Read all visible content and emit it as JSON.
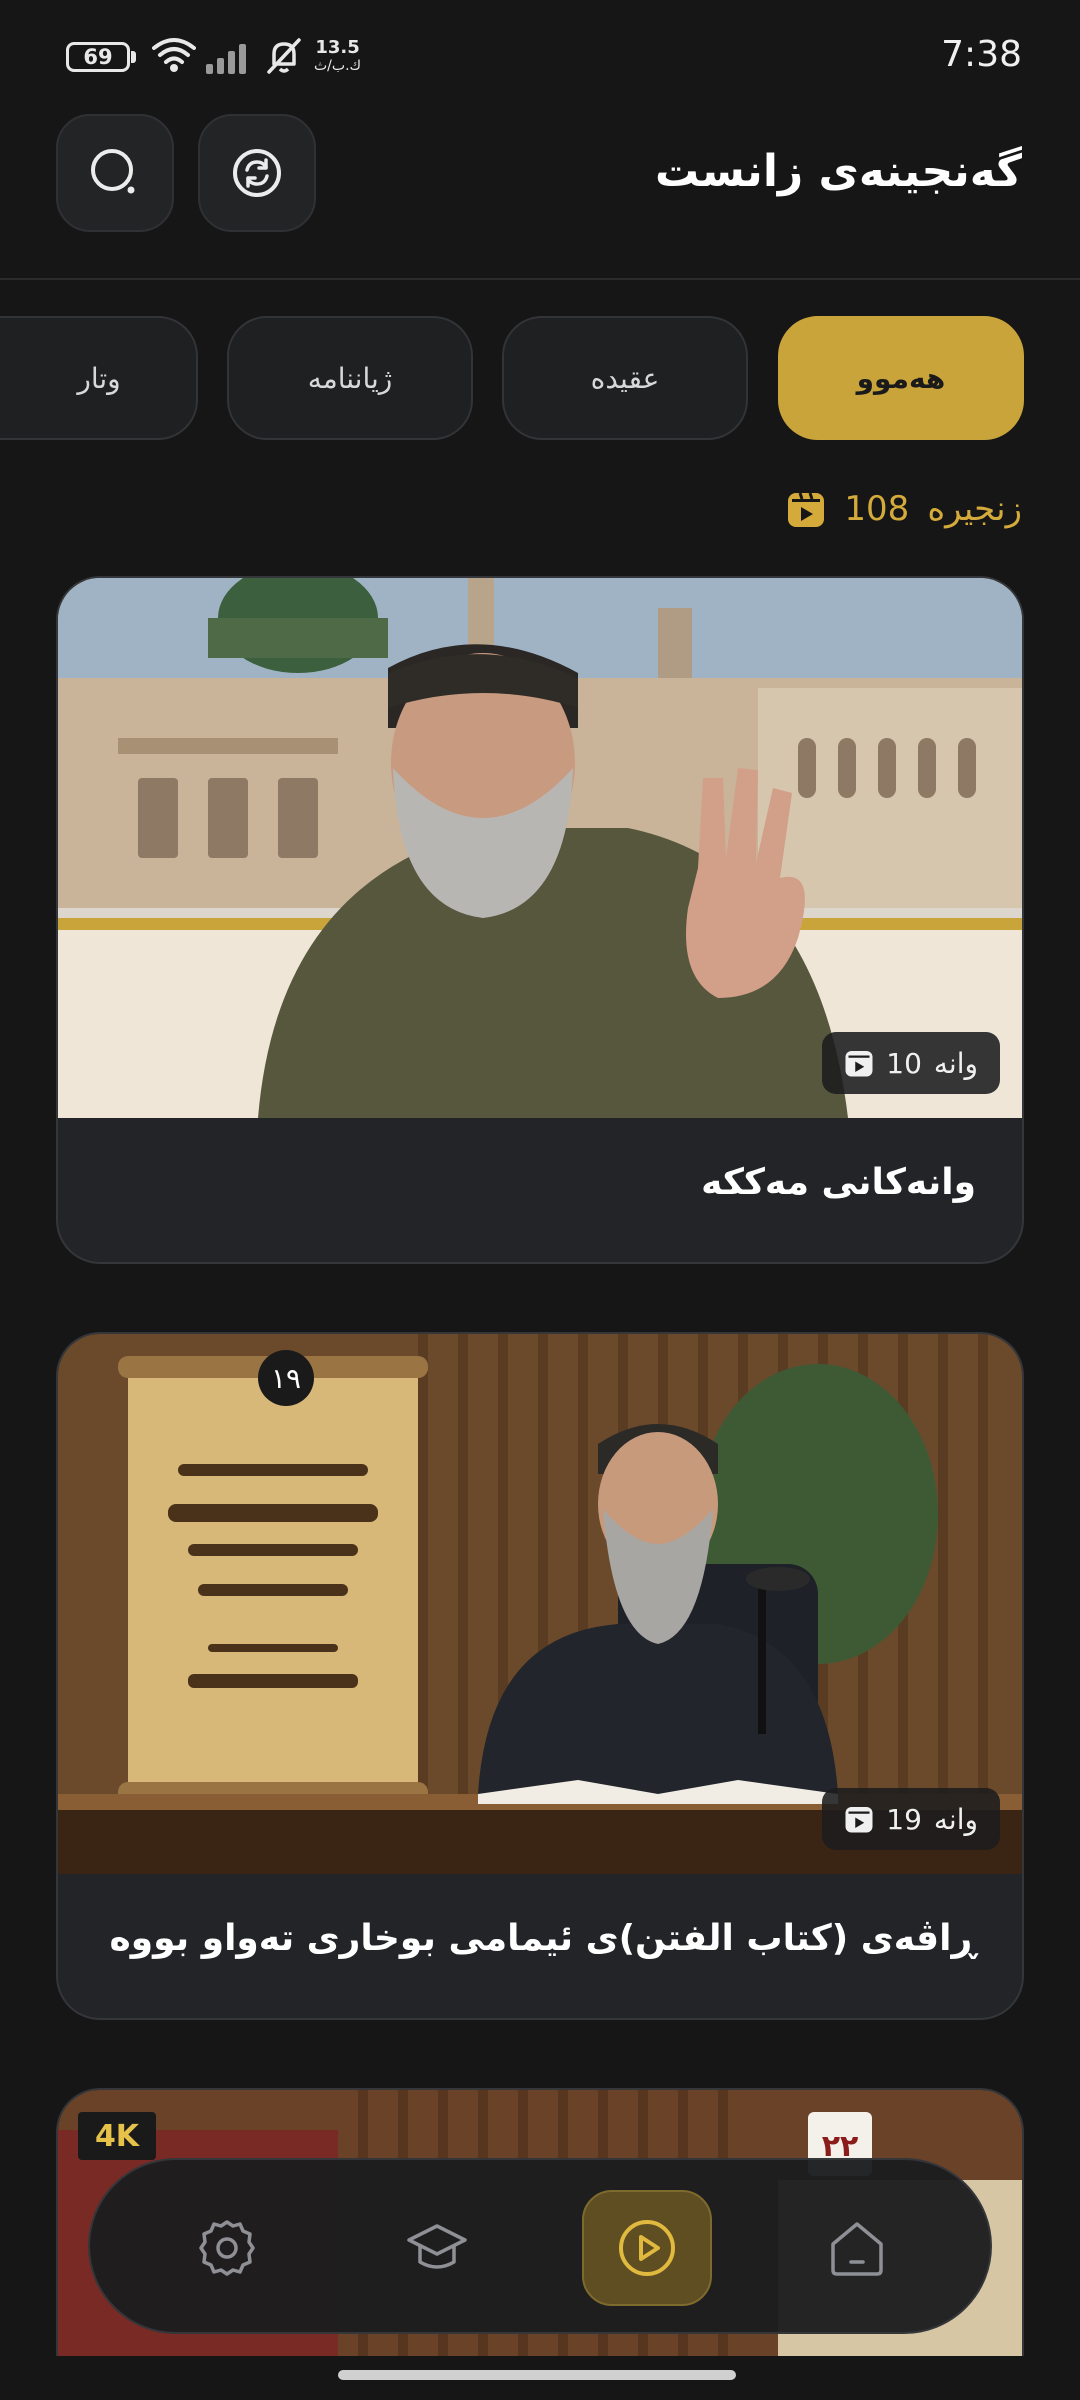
{
  "status_bar": {
    "battery": "69",
    "speed_value": "13.5",
    "speed_unit": "ك.ب/ث",
    "time": "7:38"
  },
  "header": {
    "title": "گەنجینەی زانست",
    "search_icon": "search-icon",
    "refresh_icon": "refresh-icon"
  },
  "tabs": [
    {
      "label": "هەموو",
      "active": true
    },
    {
      "label": "عقیده",
      "active": false
    },
    {
      "label": "ژیاننامە",
      "active": false
    },
    {
      "label": "وتار",
      "active": false
    }
  ],
  "series_count": {
    "number": "108",
    "label": "زنجیرە",
    "icon": "video-library-icon"
  },
  "cards": [
    {
      "title": "وانەکانی مەککە",
      "badge_number": "10",
      "badge_label": "وانە"
    },
    {
      "title": "ڕاڤەی (كتاب الفتن)ی ئیمامی بوخاری تەواو بووە",
      "badge_number": "19",
      "badge_label": "وانە"
    }
  ],
  "nav": {
    "items": [
      "settings-icon",
      "courses-icon",
      "play-icon",
      "home-icon"
    ],
    "active": "play-icon"
  },
  "colors": {
    "accent": "#c9a43a",
    "background": "#161617",
    "card": "#222427"
  }
}
